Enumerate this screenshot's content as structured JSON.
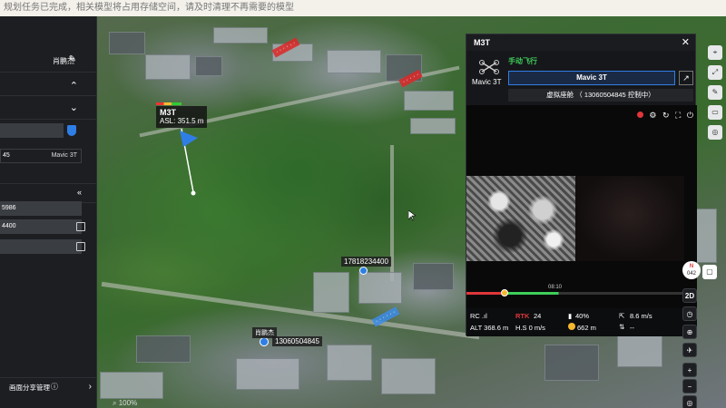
{
  "notice": "规划任务已完成，相关模型将占用存储空间，请及时清理不再需要的模型",
  "left_panel": {
    "username": "肖鹏杰",
    "field_device_code": "45",
    "field_drone": "Mavic 3T",
    "field_phone1": "5986",
    "field_phone2": "4400",
    "footer_label": "画面分享管理"
  },
  "map": {
    "drone_tag_name": "M3T",
    "drone_tag_asl": "ASL: 351.5 m",
    "pilot1_phone": "17818234400",
    "pilot2_name": "肖鹏杰",
    "pilot2_phone": "13060504845",
    "zoom": "100%"
  },
  "drone_window": {
    "title": "M3T",
    "model": "Mavic 3T",
    "mode": "手动飞行",
    "device_name": "Mavic 3T",
    "control_text": "虚拟座舱 （ 13060504845 控制中）",
    "timeline_time": "08:10",
    "status": {
      "rc": "RC .ıl",
      "rtk_label": "RTK",
      "rtk_value": "24",
      "battery": "40%",
      "speed": "8.6 m/s",
      "alt": "ALT 368.6 m",
      "hs": "H.S 0 m/s",
      "distance": "662 m",
      "vs": "--"
    }
  },
  "tools": {
    "compass_letter": "N",
    "compass_value": "042",
    "view_2d": "2D"
  },
  "colors": {
    "accent_blue": "#2f7ee6",
    "mode_green": "#3ecf5a",
    "record_red": "#e0363a"
  }
}
